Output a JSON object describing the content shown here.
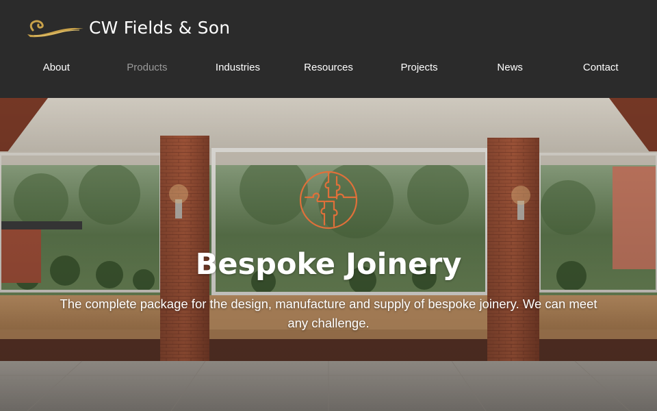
{
  "brand": {
    "name": "CW Fields & Son",
    "logo_icon": "swoosh-logo-icon",
    "accent": "#c9a24a"
  },
  "nav": {
    "items": [
      {
        "label": "About",
        "active": false
      },
      {
        "label": "Products",
        "active": true
      },
      {
        "label": "Industries",
        "active": false
      },
      {
        "label": "Resources",
        "active": false
      },
      {
        "label": "Projects",
        "active": false
      },
      {
        "label": "News",
        "active": false
      },
      {
        "label": "Contact",
        "active": false
      }
    ]
  },
  "hero": {
    "icon": "puzzle-circle-icon",
    "icon_color": "#e0703a",
    "title": "Bespoke Joinery",
    "subtitle": "The complete package for the design, manufacture and supply of bespoke joinery. We can meet any challenge."
  },
  "colors": {
    "header_bg": "#2b2b2b",
    "nav_text": "#ffffff",
    "nav_active": "#9a9a9a"
  }
}
